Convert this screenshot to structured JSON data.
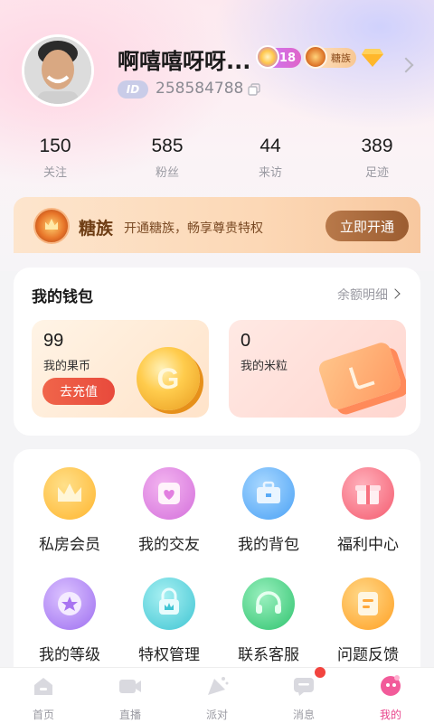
{
  "profile": {
    "nickname": "啊嘻嘻呀呀...",
    "level": "18",
    "vip_badge": "糖族",
    "id_tag": "ID",
    "id_number": "258584788"
  },
  "stats": [
    {
      "value": "150",
      "label": "关注"
    },
    {
      "value": "585",
      "label": "粉丝"
    },
    {
      "value": "44",
      "label": "来访"
    },
    {
      "value": "389",
      "label": "足迹"
    }
  ],
  "vip_banner": {
    "name": "糖族",
    "desc": "开通糖族，畅享尊贵特权",
    "button": "立即开通"
  },
  "wallet": {
    "title": "我的钱包",
    "detail_link": "余额明细",
    "fruit": {
      "amount": "99",
      "label": "我的果币",
      "button": "去充值"
    },
    "rice": {
      "amount": "0",
      "label": "我的米粒"
    }
  },
  "features": [
    {
      "label": "私房会员",
      "icon": "crown-icon",
      "color": "#ffc24a"
    },
    {
      "label": "我的交友",
      "icon": "heart-card-icon",
      "color": "#e787e6"
    },
    {
      "label": "我的背包",
      "icon": "backpack-icon",
      "color": "#67b8ff"
    },
    {
      "label": "福利中心",
      "icon": "gift-icon",
      "color": "#ff6f80"
    },
    {
      "label": "我的等级",
      "icon": "level-star-icon",
      "color": "#b98bf5"
    },
    {
      "label": "特权管理",
      "icon": "privilege-icon",
      "color": "#5cd6e0"
    },
    {
      "label": "联系客服",
      "icon": "headset-icon",
      "color": "#4fd48a"
    },
    {
      "label": "问题反馈",
      "icon": "feedback-icon",
      "color": "#ffb34a"
    }
  ],
  "tabs": [
    {
      "label": "首页",
      "icon": "home-icon",
      "active": false
    },
    {
      "label": "直播",
      "icon": "video-icon",
      "active": false
    },
    {
      "label": "派对",
      "icon": "party-icon",
      "active": false
    },
    {
      "label": "消息",
      "icon": "message-icon",
      "active": false
    },
    {
      "label": "我的",
      "icon": "me-icon",
      "active": true
    }
  ],
  "colors": {
    "accent": "#e8458c",
    "recharge": "#e84a3c",
    "vip_button": "#9c5d31"
  }
}
